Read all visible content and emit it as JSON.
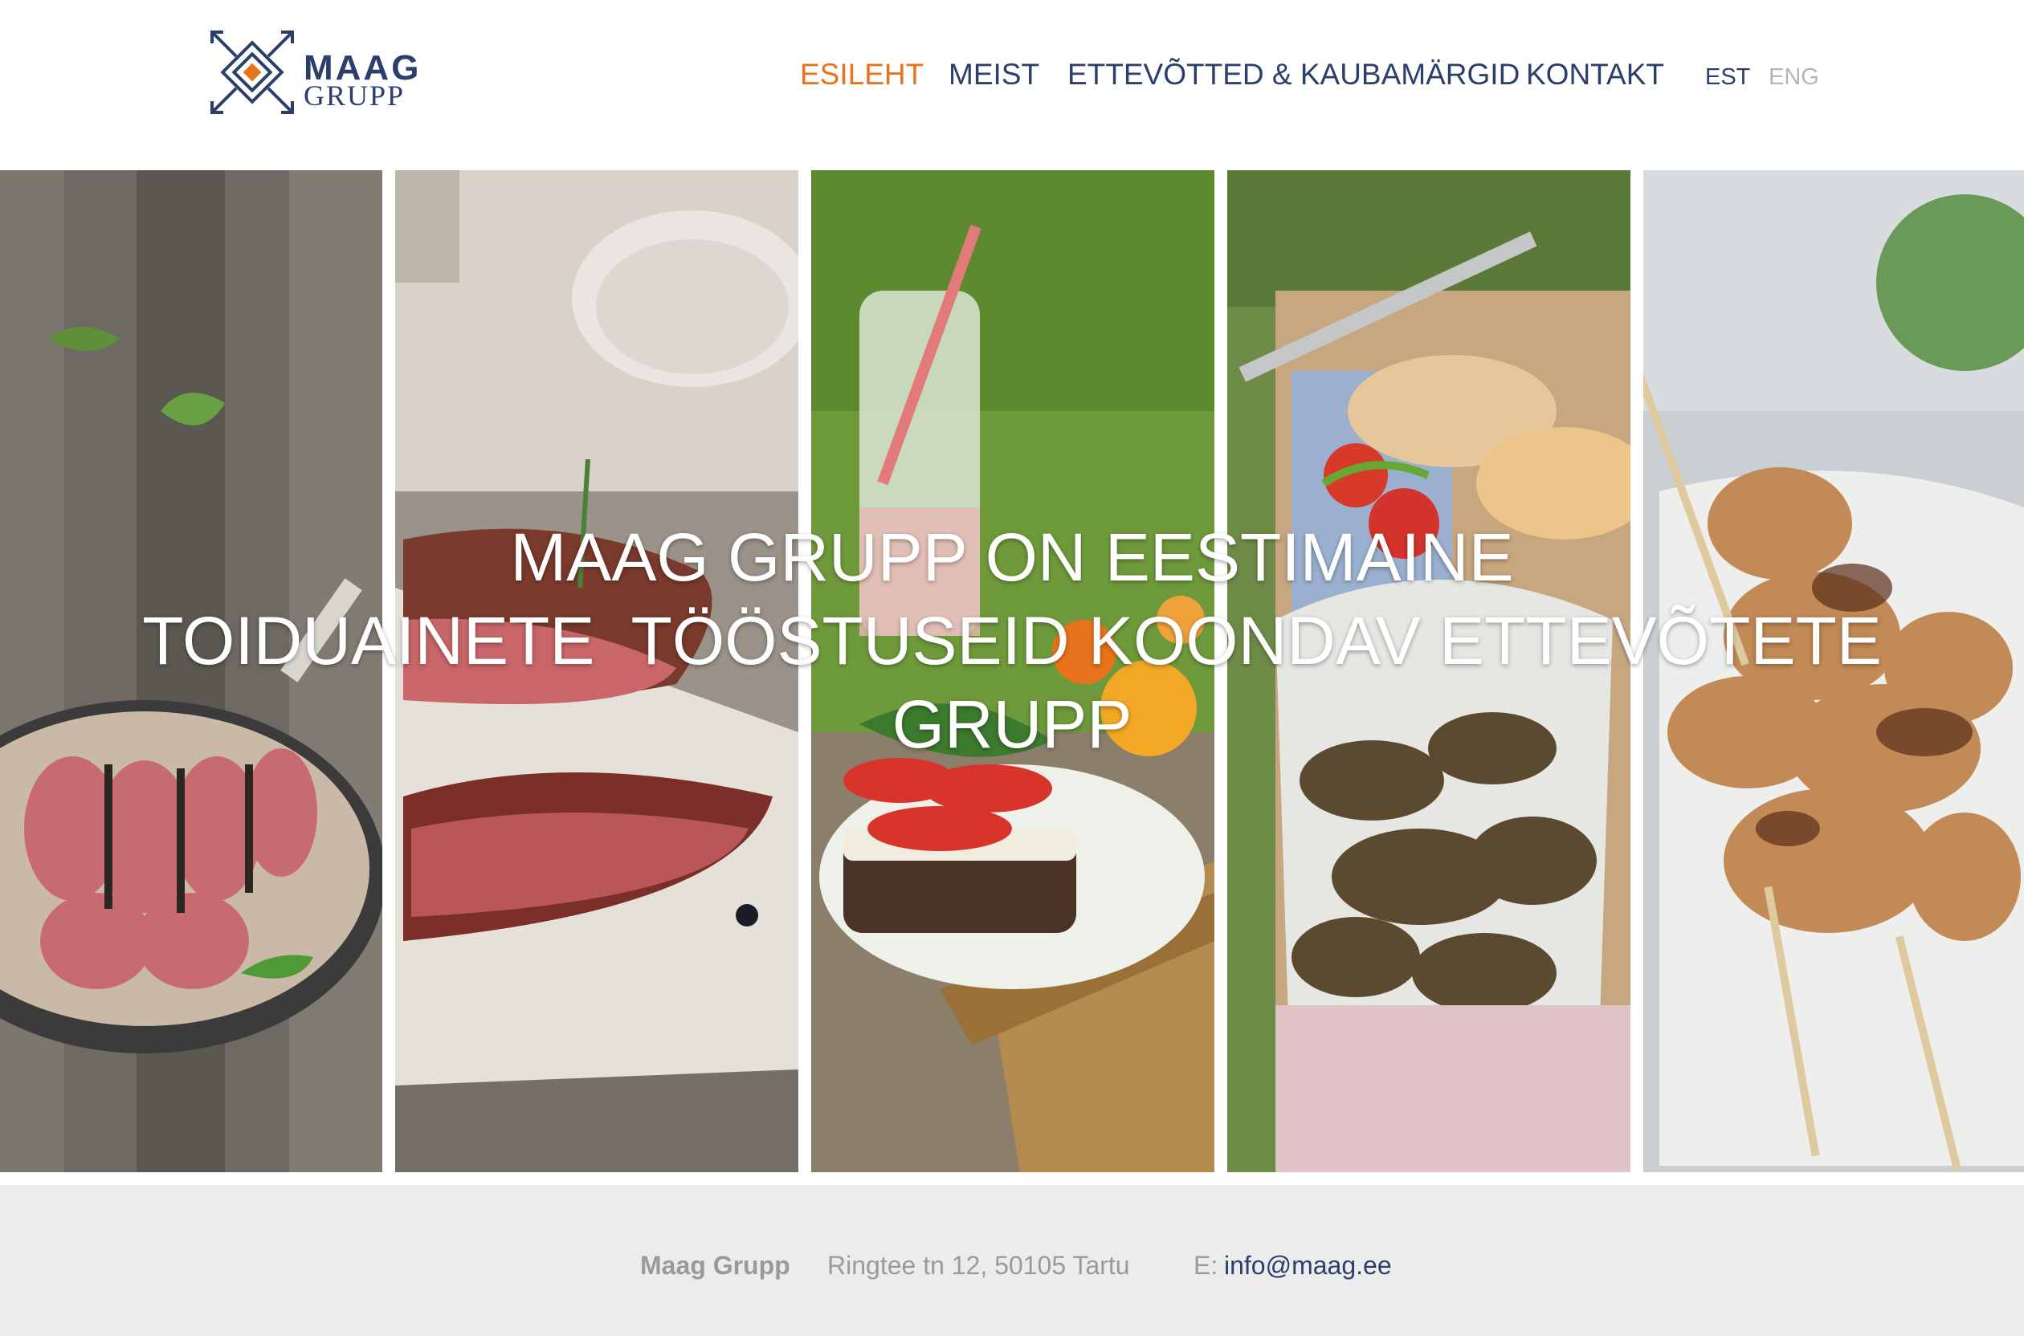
{
  "header": {
    "logo": {
      "word": "MAAG",
      "sub": "GRUPP"
    },
    "nav": [
      {
        "label": "ESILEHT",
        "active": true
      },
      {
        "label": "MEIST",
        "active": false
      },
      {
        "label": "ETTEVÕTTED & KAUBAMÄRGID",
        "active": false
      },
      {
        "label": "KONTAKT",
        "active": false
      }
    ],
    "languages": [
      {
        "label": "EST",
        "active": true
      },
      {
        "label": "ENG",
        "active": false
      }
    ]
  },
  "hero": {
    "title_lines": [
      "MAAG GRUPP ON EESTIMAINE",
      "TOIDUAINETE  TÖÖSTUSEID KOONDAV ETTEVÕTETE",
      "GRUPP"
    ],
    "panels": [
      {
        "subject": "sliced roast meat in pan on wooden table"
      },
      {
        "subject": "grilled steak on cutting board"
      },
      {
        "subject": "tomato open sandwich with carafe on grass"
      },
      {
        "subject": "roasted chicken wings in picnic box with bread"
      },
      {
        "subject": "chicken skewers on newspaper"
      }
    ]
  },
  "footer": {
    "company": "Maag Grupp",
    "address": "Ringtee tn 12, 50105 Tartu",
    "email_label": "E:",
    "email": "info@maag.ee"
  },
  "colors": {
    "brand_navy": "#2c3f6b",
    "accent_orange": "#e8731c",
    "muted_grey": "#9a9a9a",
    "footer_bg": "#ececec"
  }
}
